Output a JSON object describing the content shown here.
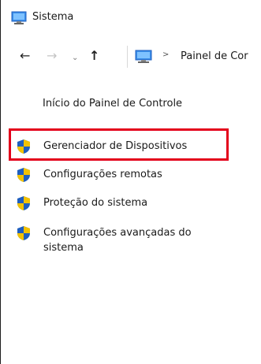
{
  "window": {
    "title": "Sistema"
  },
  "navigation": {
    "back_icon": "←",
    "forward_icon": "→",
    "dropdown_icon": "⌄",
    "up_icon": "↑",
    "address_separator": ">",
    "address_text": "Painel de Cor"
  },
  "sidebar": {
    "home_link": "Início do Painel de Controle",
    "items": [
      {
        "label": "Gerenciador de Dispositivos",
        "icon": "shield-icon"
      },
      {
        "label": "Configurações remotas",
        "icon": "shield-icon"
      },
      {
        "label": "Proteção do sistema",
        "icon": "shield-icon"
      },
      {
        "label": "Configurações avançadas do sistema",
        "icon": "shield-icon"
      }
    ]
  },
  "colors": {
    "highlight_border": "#e3001b",
    "shield_blue": "#1f5fbf",
    "shield_yellow": "#f2c200"
  }
}
